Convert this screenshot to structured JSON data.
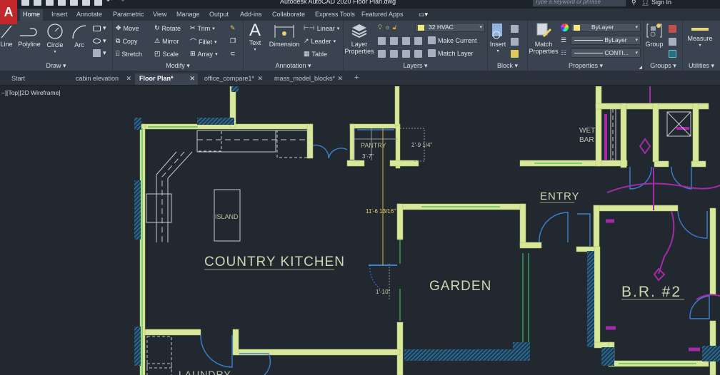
{
  "titlebar": {
    "app_logo": "A",
    "title": "Autodesk AutoCAD 2020   Floor Plan.dwg",
    "search_placeholder": "Type a keyword or phrase",
    "sign_in": "Sign In"
  },
  "ribbon_tabs": [
    "Home",
    "Insert",
    "Annotate",
    "Parametric",
    "View",
    "Manage",
    "Output",
    "Add-ins",
    "Collaborate",
    "Express Tools",
    "Featured Apps"
  ],
  "ribbon": {
    "draw": {
      "title": "Draw ▾",
      "line": "Line",
      "polyline": "Polyline",
      "circle": "Circle",
      "arc": "Arc"
    },
    "modify": {
      "title": "Modify ▾",
      "move": "Move",
      "rotate": "Rotate",
      "trim": "Trim",
      "copy": "Copy",
      "mirror": "Mirror",
      "fillet": "Fillet",
      "stretch": "Stretch",
      "scale": "Scale",
      "array": "Array"
    },
    "annotation": {
      "title": "Annotation ▾",
      "text": "Text",
      "dimension": "Dimension",
      "linear": "Linear",
      "leader": "Leader",
      "table": "Table"
    },
    "layers": {
      "title": "Layers ▾",
      "layer_properties_1": "Layer",
      "layer_properties_2": "Properties",
      "current_layer": "32 HVAC",
      "make_current": "Make Current",
      "match_layer": "Match Layer"
    },
    "block": {
      "title": "Block ▾",
      "insert": "Insert"
    },
    "properties": {
      "title": "Properties ▾",
      "match_1": "Match",
      "match_2": "Properties",
      "color": "ByLayer",
      "lineweight": "ByLayer",
      "linetype": "CONTI..."
    },
    "groups": {
      "title": "Groups ▾",
      "group": "Group"
    },
    "utilities": {
      "title": "Utilities ▾",
      "measure": "Measure"
    }
  },
  "doc_tabs": [
    {
      "label": "Start",
      "closable": false,
      "active": false
    },
    {
      "label": "cabin elevation",
      "closable": true,
      "active": false
    },
    {
      "label": "Floor Plan*",
      "closable": true,
      "active": true
    },
    {
      "label": "office_compare1*",
      "closable": true,
      "active": false
    },
    {
      "label": "mass_model_blocks*",
      "closable": true,
      "active": false
    }
  ],
  "doc_tab_close": "✕",
  "doc_tab_add": "+",
  "viewport": {
    "label": "–][Top][2D Wireframe]",
    "rooms": {
      "kitchen": "COUNTRY KITCHEN",
      "garden": "GARDEN",
      "entry": "ENTRY",
      "bedroom": "B.R. #2",
      "wet_bar_1": "WET",
      "wet_bar_2": "BAR",
      "pantry": "PANTRY",
      "island": "ISLAND",
      "laundry": "LAUNDRY"
    },
    "dimensions": {
      "pantry_width": "3'-7\"",
      "pantry_depth": "2'-9 1/4\"",
      "vertical": "11'-6 13/16\"",
      "door": "1'-10\""
    }
  },
  "colors": {
    "background": "#212830",
    "wall": "#d8e79a",
    "window": "#3fbf5a",
    "door": "#3e7fd0",
    "hatch": "#3a8fc7",
    "hvac": "#a52aa8",
    "dimension": "#e0b640",
    "label": "#c9d9b0"
  }
}
